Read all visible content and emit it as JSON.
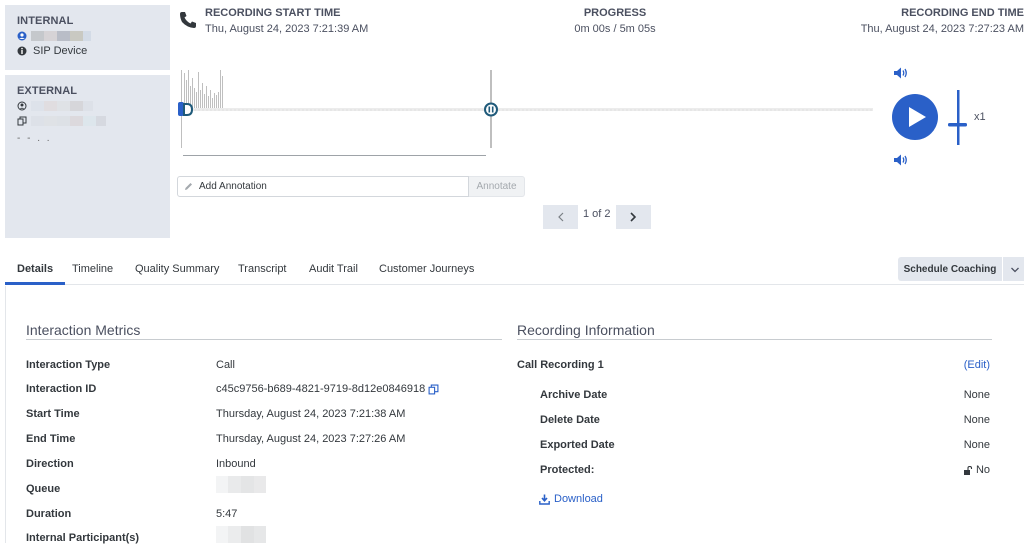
{
  "participants": {
    "internal": {
      "title": "INTERNAL",
      "device": "SIP Device"
    },
    "external": {
      "title": "EXTERNAL",
      "extra": "- -   . ."
    }
  },
  "header": {
    "start": {
      "label": "RECORDING START TIME",
      "value": "Thu, August 24, 2023 7:21:39 AM"
    },
    "progress": {
      "label": "PROGRESS",
      "value": "0m 00s / 5m 05s",
      "fraction": 0.0
    },
    "end": {
      "label": "RECORDING END TIME",
      "value": "Thu, August 24, 2023 7:27:23 AM"
    }
  },
  "player": {
    "speed": "x1",
    "play_icon": "play-icon",
    "volume_icon": "volume-icon"
  },
  "annotation": {
    "placeholder": "Add Annotation",
    "button": "Annotate"
  },
  "pager": {
    "text": "1 of 2",
    "current": 1,
    "total": 2
  },
  "tabs": [
    {
      "label": "Details",
      "active": true
    },
    {
      "label": "Timeline"
    },
    {
      "label": "Quality Summary"
    },
    {
      "label": "Transcript"
    },
    {
      "label": "Audit Trail"
    },
    {
      "label": "Customer Journeys"
    }
  ],
  "actions": {
    "schedule_coaching": "Schedule Coaching"
  },
  "metrics": {
    "title": "Interaction Metrics",
    "rows": [
      {
        "label": "Interaction Type",
        "value": "Call"
      },
      {
        "label": "Interaction ID",
        "value": "c45c9756-b689-4821-9719-8d12e0846918"
      },
      {
        "label": "Start Time",
        "value": "Thursday, August 24, 2023 7:21:38 AM"
      },
      {
        "label": "End Time",
        "value": "Thursday, August 24, 2023 7:27:26 AM"
      },
      {
        "label": "Direction",
        "value": "Inbound"
      },
      {
        "label": "Queue",
        "value": ""
      },
      {
        "label": "Duration",
        "value": "5:47"
      },
      {
        "label": "Internal Participant(s)",
        "value": ""
      }
    ]
  },
  "recording": {
    "title": "Recording Information",
    "name": "Call Recording 1",
    "edit": "(Edit)",
    "rows": [
      {
        "label": "Archive Date",
        "value": "None"
      },
      {
        "label": "Delete Date",
        "value": "None"
      },
      {
        "label": "Exported Date",
        "value": "None"
      },
      {
        "label": "Protected:",
        "value": "No"
      }
    ],
    "download": "Download"
  },
  "colors": {
    "accent": "#2a60c8",
    "panel": "#e3e7ee",
    "text": "#33383d",
    "muted": "#4b5060"
  }
}
